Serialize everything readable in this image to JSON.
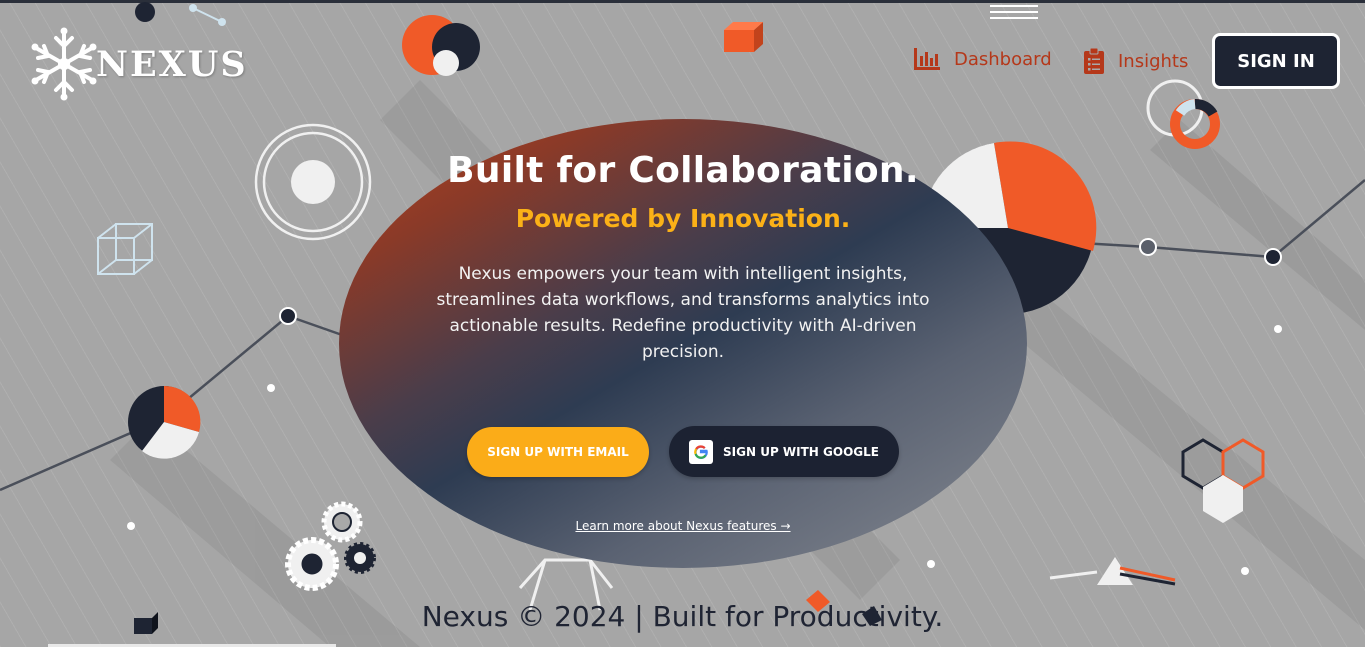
{
  "brand": {
    "name": "NEXUS",
    "icon": "snowflake-icon"
  },
  "nav": {
    "dashboard": {
      "label": "Dashboard",
      "icon": "bar-chart-icon"
    },
    "insights": {
      "label": "Insights",
      "icon": "clipboard-icon"
    },
    "signin_label": "SIGN IN"
  },
  "hero": {
    "title": "Built for Collaboration.",
    "subtitle": "Powered by Innovation.",
    "description": "Nexus empowers your team with intelligent insights, streamlines data workflows, and transforms analytics into actionable results. Redefine productivity with AI-driven precision.",
    "email_button": "SIGN UP WITH EMAIL",
    "google_button": "SIGN UP WITH GOOGLE",
    "learn_more": "Learn more about Nexus features →"
  },
  "footer": {
    "text": "Nexus © 2024 | Built for Productivity."
  },
  "colors": {
    "accent_orange": "#f05a28",
    "accent_yellow": "#fbb117",
    "navy": "#1e2433",
    "nav_link": "#b5381a"
  }
}
